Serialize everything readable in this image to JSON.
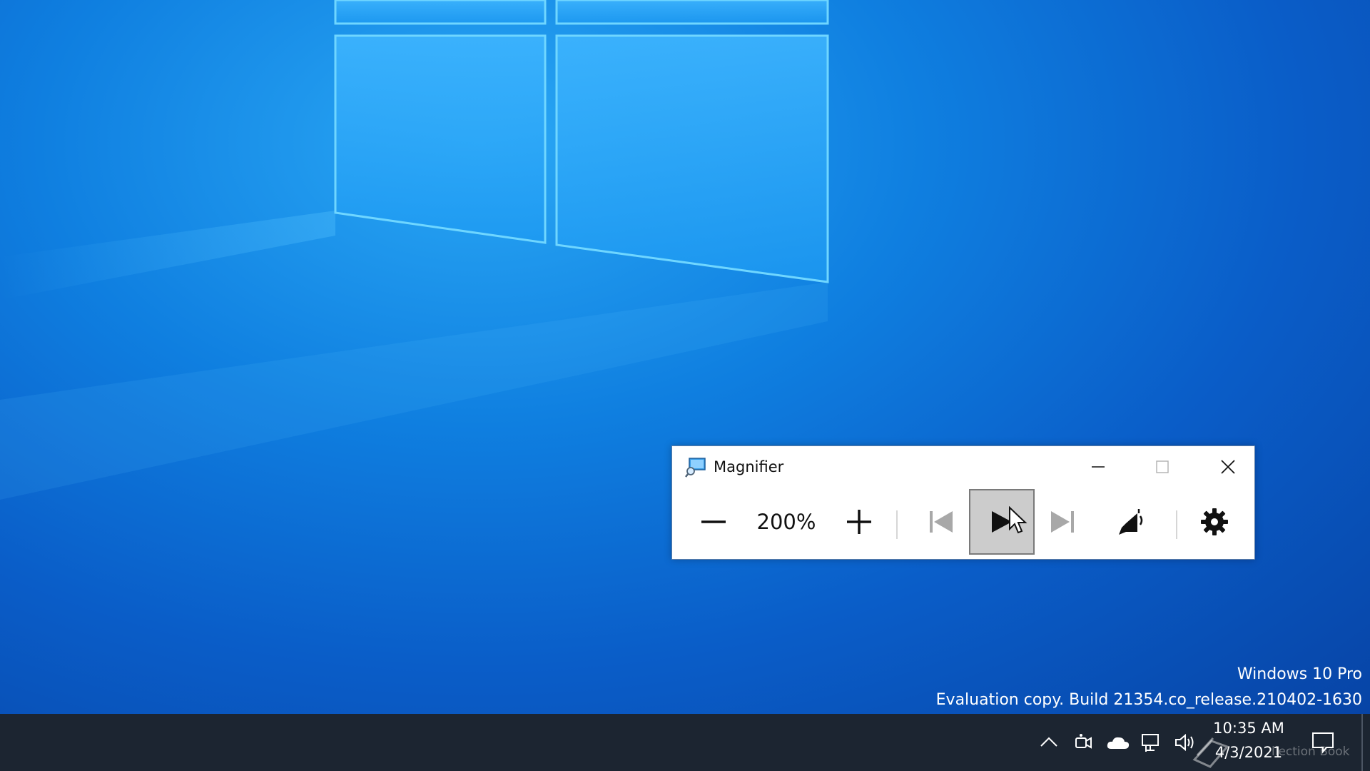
{
  "desktop": {
    "watermark_edition": "Windows 10 Pro",
    "watermark_build": "Evaluation copy. Build 21354.co_release.210402-1630"
  },
  "magnifier": {
    "title": "Magnifier",
    "app_icon": "magnifier-icon",
    "zoom_level": "200%",
    "controls": {
      "zoom_out_icon": "minus-icon",
      "zoom_in_icon": "plus-icon",
      "previous_icon": "skip-previous-icon",
      "play_icon": "play-icon",
      "next_icon": "skip-next-icon",
      "voice_icon": "speaker-voice-icon",
      "settings_icon": "gear-icon"
    },
    "caption_buttons": [
      "minimize-icon",
      "maximize-icon",
      "close-icon"
    ]
  },
  "taskbar": {
    "tray_icons": [
      "chevron-up-icon",
      "meet-now-icon",
      "onedrive-cloud-icon",
      "network-icon",
      "volume-icon"
    ],
    "clock_time": "10:35 AM",
    "clock_date": "4/3/2021",
    "notification_icon": "action-center-icon",
    "overlay_text": "llection Book"
  },
  "colors": {
    "desktop_accent": "#0f7fe0",
    "taskbar_bg": "#1c2531",
    "play_button_bg": "#cccccc"
  }
}
